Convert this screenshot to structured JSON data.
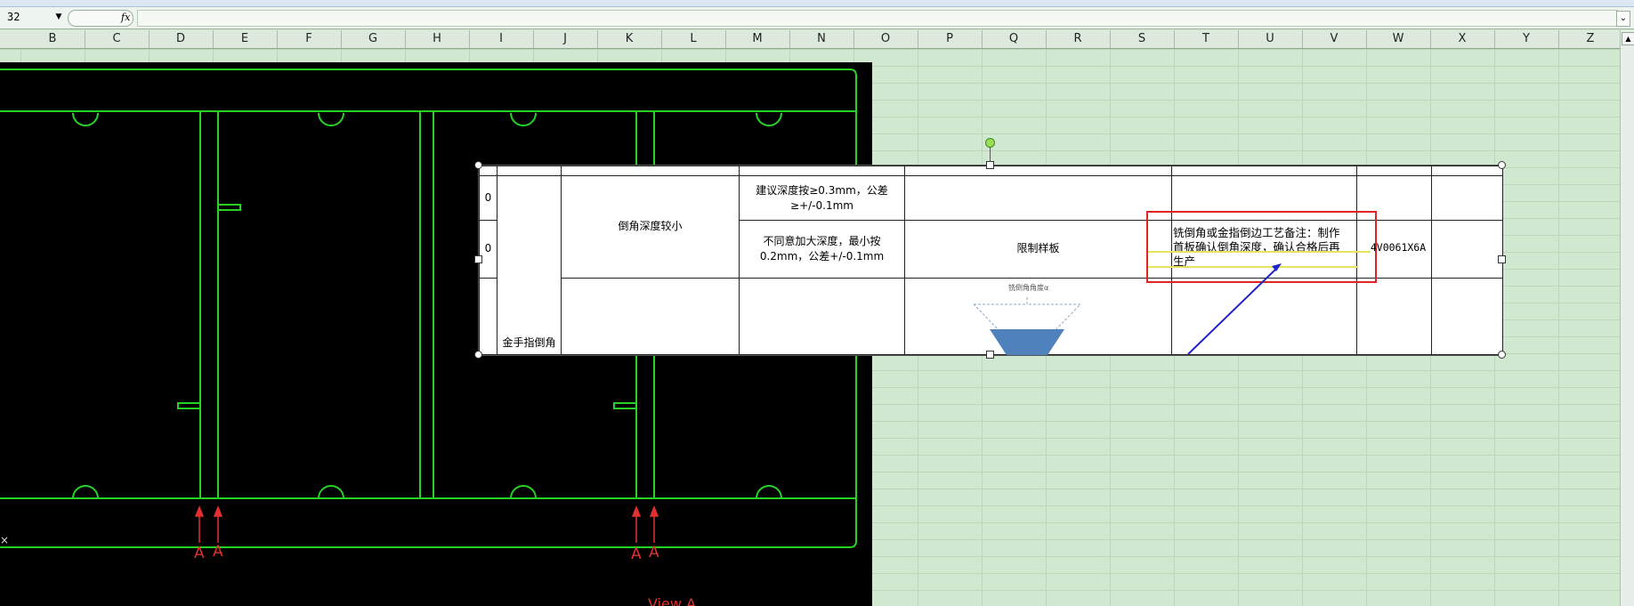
{
  "formula_bar": {
    "name_box": "32",
    "fx": "fx",
    "formula_value": ""
  },
  "columns": [
    "B",
    "C",
    "D",
    "E",
    "F",
    "G",
    "H",
    "I",
    "J",
    "K",
    "L",
    "M",
    "N",
    "O",
    "P",
    "Q",
    "R",
    "S",
    "T",
    "U",
    "V",
    "W",
    "X",
    "Y",
    "Z"
  ],
  "cad_drawing": {
    "markers": [
      "A",
      "A",
      "A",
      "A"
    ],
    "view_label": "View A"
  },
  "table": {
    "row_labels": [
      "0",
      "0"
    ],
    "category": "金手指倒角",
    "issue": "倒角深度较小",
    "suggestion_1": "建议深度按≥0.3mm，公差≥+/-0.1mm",
    "suggestion_2": "不同意加大深度，最小按0.2mm，公差+/-0.1mm",
    "action": "限制样板",
    "diagram_label": "铣倒角角度α",
    "note": "铣倒角或金指倒边工艺备注：制作首板确认倒角深度，确认合格后再生产",
    "part_number": "4V0061X6A"
  },
  "colors": {
    "sheet_bg": "#cfe8cf",
    "cad_line": "#27d227",
    "cad_marker": "#e23030",
    "highlight_box": "#e02424",
    "arrow": "#2222cc",
    "diagram_fill": "#4f81bd"
  }
}
